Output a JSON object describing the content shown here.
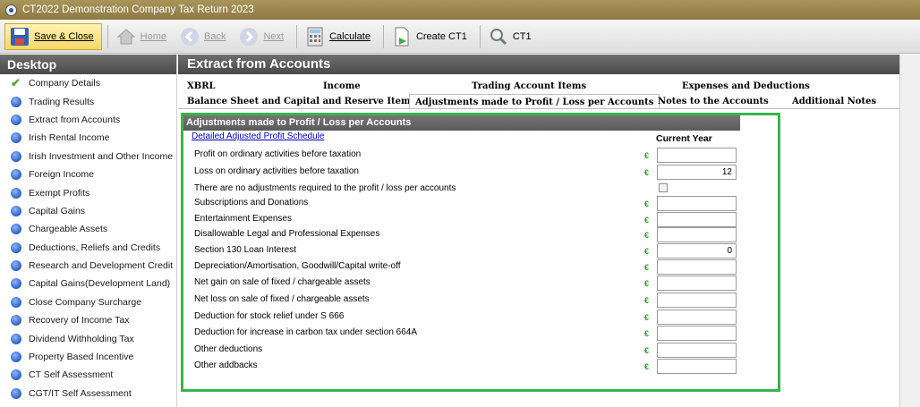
{
  "window": {
    "title": "CT2022 Demonstration Company Tax Return 2023"
  },
  "toolbar": {
    "save_close": "Save & Close",
    "home": "Home",
    "back": "Back",
    "next": "Next",
    "calculate": "Calculate",
    "create_ct1": "Create CT1",
    "ct1": "CT1"
  },
  "sidebar": {
    "title": "Desktop",
    "items": [
      {
        "label": "Company Details",
        "icon": "checkmark-icon"
      },
      {
        "label": "Trading Results",
        "icon": "blue-globe-icon"
      },
      {
        "label": "Extract from Accounts",
        "icon": "blue-globe-icon"
      },
      {
        "label": "Irish Rental Income",
        "icon": "blue-globe-icon"
      },
      {
        "label": "Irish Investment and Other Income",
        "icon": "blue-globe-icon"
      },
      {
        "label": "Foreign Income",
        "icon": "blue-globe-icon"
      },
      {
        "label": "Exempt Profits",
        "icon": "blue-globe-icon"
      },
      {
        "label": "Capital Gains",
        "icon": "blue-globe-icon"
      },
      {
        "label": "Chargeable Assets",
        "icon": "blue-globe-icon"
      },
      {
        "label": "Deductions, Reliefs and Credits",
        "icon": "blue-globe-icon"
      },
      {
        "label": "Research and Development Credit",
        "icon": "blue-globe-icon"
      },
      {
        "label": "Capital Gains(Development Land)",
        "icon": "blue-globe-icon"
      },
      {
        "label": "Close Company Surcharge",
        "icon": "blue-globe-icon"
      },
      {
        "label": "Recovery of Income Tax",
        "icon": "blue-globe-icon"
      },
      {
        "label": "Dividend Withholding Tax",
        "icon": "blue-globe-icon"
      },
      {
        "label": "Property Based Incentive",
        "icon": "blue-globe-icon"
      },
      {
        "label": "CT Self Assessment",
        "icon": "blue-globe-icon"
      },
      {
        "label": "CGT/IT Self Assessment",
        "icon": "blue-globe-icon"
      }
    ]
  },
  "main": {
    "title": "Extract from Accounts",
    "tabs_row1": [
      "XBRL",
      "Income",
      "Trading Account Items",
      "Expenses and Deductions"
    ],
    "tabs_row2": [
      "Balance Sheet and Capital and Reserve Items",
      "Adjustments made to Profit / Loss per Accounts",
      "Notes to the Accounts",
      "Additional Notes"
    ],
    "selected_tab": "Adjustments made to Profit / Loss per Accounts"
  },
  "section": {
    "title": "Adjustments made to Profit / Loss per Accounts",
    "link": "Detailed Adjusted Profit Schedule",
    "column_header": "Current Year",
    "currency_symbol": "€",
    "rows": [
      {
        "label": "Profit on ordinary activities before taxation",
        "value": ""
      },
      {
        "label": "Loss on ordinary activities before taxation",
        "value": "12"
      },
      {
        "label": "There are no adjustments required to the profit / loss per accounts",
        "checkbox": false
      },
      {
        "label": "Subscriptions and Donations",
        "value": ""
      },
      {
        "label": "Entertainment Expenses",
        "value": ""
      },
      {
        "label": "Disallowable Legal and Professional Expenses",
        "value": ""
      },
      {
        "label": "Section 130 Loan Interest",
        "value": "0"
      },
      {
        "label": "Depreciation/Amortisation, Goodwill/Capital write-off",
        "value": ""
      },
      {
        "label": "Net gain on sale of fixed / chargeable assets",
        "value": ""
      },
      {
        "label": "Net loss on sale of fixed / chargeable assets",
        "value": ""
      },
      {
        "label": "Deduction for stock relief under S 666",
        "value": ""
      },
      {
        "label": "Deduction for increase in carbon tax under section 664A",
        "value": ""
      },
      {
        "label": "Other deductions",
        "value": ""
      },
      {
        "label": "Other addbacks",
        "value": ""
      }
    ]
  },
  "colors": {
    "accent_green": "#38b54a",
    "header_gray": "#5a5a5a",
    "title_bar": "#8e7a42",
    "link_blue": "#0000d0"
  }
}
